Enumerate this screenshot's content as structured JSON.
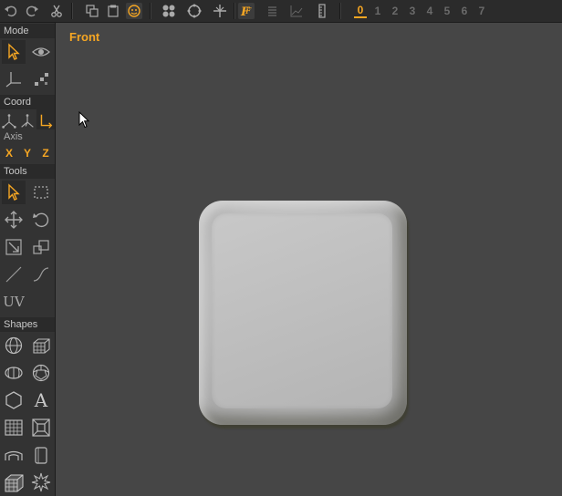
{
  "toolbar": {
    "icons": [
      "undo-icon",
      "redo-icon",
      "cut-icon",
      "copy-icon",
      "paste-icon",
      "snap-icon",
      "grid-icon",
      "sphere-icon",
      "transform-icon",
      "fx-icon",
      "list-icon",
      "graph-icon",
      "ruler-icon"
    ],
    "layers": [
      "0",
      "1",
      "2",
      "3",
      "4",
      "5",
      "6",
      "7"
    ],
    "active_layer": "0"
  },
  "panel": {
    "mode_label": "Mode",
    "coord_label": "Coord",
    "axis_label": "Axis",
    "axis_x": "X",
    "axis_y": "Y",
    "axis_z": "Z",
    "tools_label": "Tools",
    "uv_label": "UV",
    "shapes_label": "Shapes",
    "text_tool_label": "A"
  },
  "viewport": {
    "title": "Front"
  },
  "colors": {
    "accent": "#f5a623",
    "panel_bg": "#333333",
    "viewport_bg": "#464646"
  }
}
